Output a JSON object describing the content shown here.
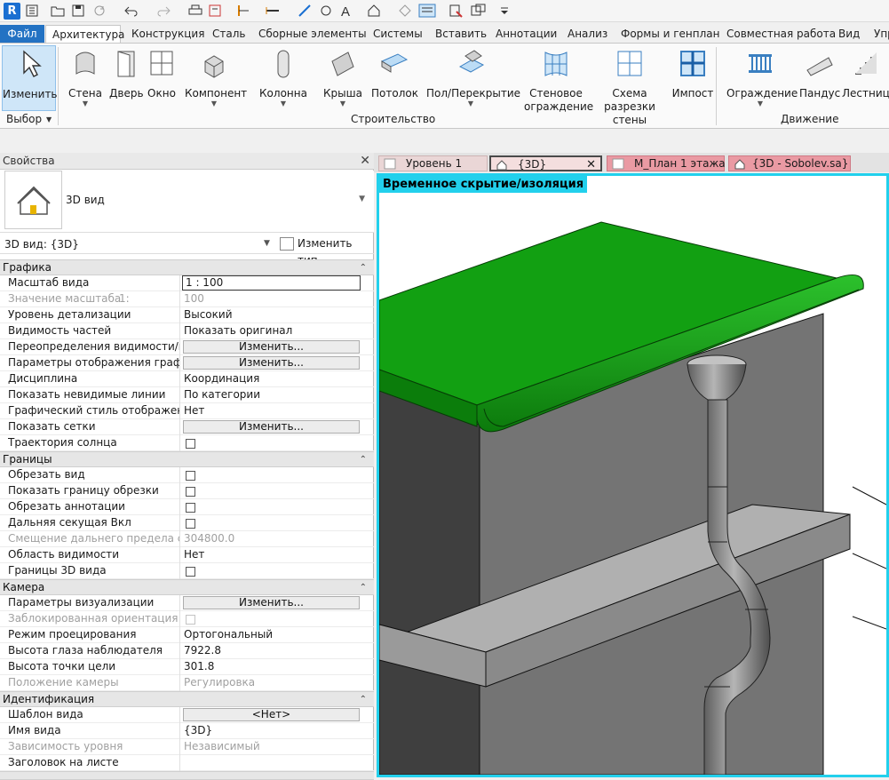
{
  "app": {
    "logo": "R"
  },
  "ribbon_tabs": [
    "Файл",
    "Архитектура",
    "Конструкция",
    "Сталь",
    "Сборные элементы",
    "Системы",
    "Вставить",
    "Аннотации",
    "Анализ",
    "Формы и генплан",
    "Совместная работа",
    "Вид",
    "Упр"
  ],
  "ribbon": {
    "buttons": {
      "modify": "Изменить",
      "wall": "Стена",
      "door": "Дверь",
      "window": "Окно",
      "component": "Компонент",
      "column": "Колонна",
      "roof": "Крыша",
      "ceiling": "Потолок",
      "floor": "Пол/Перекрытие",
      "curtain_system": "Стеновое ограждение",
      "curtain_grid": "Схема разрезки стены",
      "mullion": "Импост",
      "railing": "Ограждение",
      "ramp": "Пандус",
      "stair": "Лестница"
    },
    "panels": {
      "select": "Выбор",
      "build": "Строительство",
      "circulation": "Движение"
    }
  },
  "properties": {
    "title": "Свойства",
    "type_name": "3D вид",
    "selector": "3D вид: {3D}",
    "edit_type": "Изменить тип",
    "groups": {
      "graphics": {
        "label": "Графика",
        "rows": [
          {
            "name": "Масштаб вида",
            "value": "1 : 100"
          },
          {
            "name": "Значение масштаба",
            "sub": "1:",
            "value": "100"
          },
          {
            "name": "Уровень детализации",
            "value": "Высокий"
          },
          {
            "name": "Видимость частей",
            "value": "Показать оригинал"
          },
          {
            "name": "Переопределения видимости/гр...",
            "value": "Изменить..."
          },
          {
            "name": "Параметры отображения графики",
            "value": "Изменить..."
          },
          {
            "name": "Дисциплина",
            "value": "Координация"
          },
          {
            "name": "Показать невидимые линии",
            "value": "По категории"
          },
          {
            "name": "Графический стиль отображения...",
            "value": "Нет"
          },
          {
            "name": "Показать сетки",
            "value": "Изменить..."
          },
          {
            "name": "Траектория солнца",
            "value": ""
          }
        ]
      },
      "extents": {
        "label": "Границы",
        "rows": [
          {
            "name": "Обрезать вид",
            "value": ""
          },
          {
            "name": "Показать границу обрезки",
            "value": ""
          },
          {
            "name": "Обрезать аннотации",
            "value": ""
          },
          {
            "name": "Дальняя секущая Вкл",
            "value": ""
          },
          {
            "name": "Смещение дальнего предела сек...",
            "value": "304800.0"
          },
          {
            "name": "Область видимости",
            "value": "Нет"
          },
          {
            "name": "Границы 3D вида",
            "value": ""
          }
        ]
      },
      "camera": {
        "label": "Камера",
        "rows": [
          {
            "name": "Параметры визуализации",
            "value": "Изменить..."
          },
          {
            "name": "Заблокированная ориентация",
            "value": ""
          },
          {
            "name": "Режим проецирования",
            "value": "Ортогональный"
          },
          {
            "name": "Высота глаза наблюдателя",
            "value": "7922.8"
          },
          {
            "name": "Высота точки цели",
            "value": "301.8"
          },
          {
            "name": "Положение камеры",
            "value": "Регулировка"
          }
        ]
      },
      "identity": {
        "label": "Идентификация",
        "rows": [
          {
            "name": "Шаблон вида",
            "value": "<Нет>"
          },
          {
            "name": "Имя вида",
            "value": "{3D}"
          },
          {
            "name": "Зависимость уровня",
            "value": "Независимый"
          },
          {
            "name": "Заголовок на листе",
            "value": ""
          }
        ]
      }
    }
  },
  "view_tabs": [
    {
      "label": "Уровень 1"
    },
    {
      "label": "{3D}",
      "close": "✕"
    },
    {
      "label": "М_План 1 этажа"
    },
    {
      "label": "{3D - Sobolev.sa}"
    }
  ],
  "viewport": {
    "banner": "Временное скрытие/изоляция",
    "colors": {
      "border": "#22d0ec",
      "roof": "#12a012",
      "wall": "#6e6e6e",
      "pipe": "#8a8a8a"
    }
  }
}
